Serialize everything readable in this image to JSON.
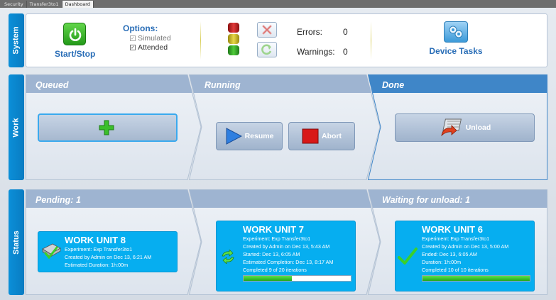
{
  "tabs": [
    "Security",
    "Transfer3to1",
    "Dashboard"
  ],
  "active_tab_index": 2,
  "sections": {
    "system": "System",
    "work": "Work",
    "status": "Status"
  },
  "system": {
    "start_stop_label": "Start/Stop",
    "options_title": "Options:",
    "options": [
      {
        "label": "Simulated",
        "checked": true,
        "enabled": false
      },
      {
        "label": "Attended",
        "checked": true,
        "enabled": true
      }
    ],
    "stack_light": [
      "red",
      "yellow",
      "green"
    ],
    "errors_label": "Errors:",
    "errors_value": "0",
    "warnings_label": "Warnings:",
    "warnings_value": "0",
    "device_tasks_label": "Device Tasks"
  },
  "work": {
    "queued_title": "Queued",
    "running_title": "Running",
    "done_title": "Done",
    "resume_label": "Resume",
    "abort_label": "Abort",
    "unload_label": "Unload",
    "icons": {
      "add": "add-plus-icon",
      "resume": "play-icon",
      "abort": "stop-icon",
      "unload": "unload-icon"
    }
  },
  "status": {
    "pending_title": "Pending: 1",
    "running_title": "",
    "waiting_title": "Waiting for unload: 1",
    "pending_card": {
      "title": "WORK UNIT 8",
      "experiment": "Experiment: Exp Transfer3to1",
      "created": "Created by Admin on  Dec 13, 6:21 AM",
      "estimated": "Estimated Duration: 1h:00m"
    },
    "running_card": {
      "title": "WORK UNIT 7",
      "experiment": "Experiment: Exp Transfer3to1",
      "created": "Created by Admin on  Dec 13, 5:43 AM",
      "started": "Started: Dec 13, 6:05 AM",
      "estimated_completion": "Estimated Completion: Dec 13, 8:17 AM",
      "completed": "Completed 9  of 20 iterations",
      "progress": 0.45
    },
    "waiting_card": {
      "title": "WORK UNIT 6",
      "experiment": "Experiment: Exp Transfer3to1",
      "created": "Created by Admin on  Dec 13, 5:00 AM",
      "ended": "Ended: Dec 13, 6:05 AM",
      "duration": "Duration: 1h:00m",
      "completed": "Completed 10  of 10  iterations",
      "progress": 1.0
    }
  },
  "colors": {
    "accent": "#06aef0",
    "label_blue": "#2a6eb7",
    "header_blue": "#0b8fd8",
    "progress_green": "#3fc52e"
  }
}
